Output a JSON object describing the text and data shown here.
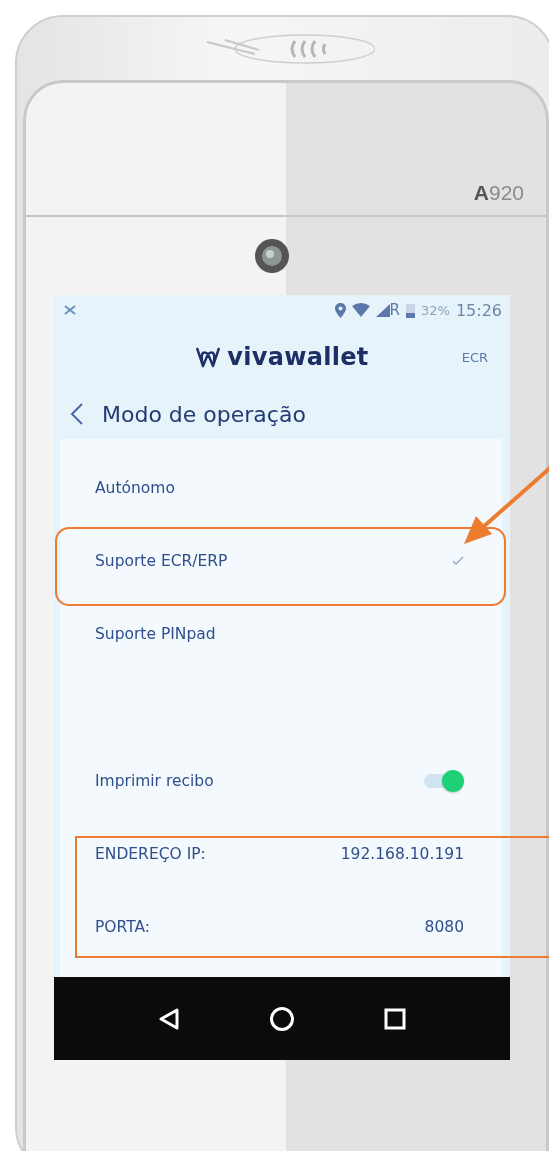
{
  "device": {
    "model": "**A**920"
  },
  "status_bar": {
    "network": "R",
    "battery": "32%",
    "time": "15:26"
  },
  "header": {
    "logo": "vivawallet",
    "mode": "ECR"
  },
  "title": "Modo de operação",
  "modes": [
    {
      "label": "Autónomo",
      "selected": false
    },
    {
      "label": "Suporte ECR/ERP",
      "selected": true
    },
    {
      "label": "Suporte PINpad",
      "selected": false
    }
  ],
  "print_receipt": {
    "label": "Imprimir recibo",
    "on": true
  },
  "fields": [
    {
      "label": "ENDEREÇO IP:",
      "value": "192.168.10.191"
    },
    {
      "label": "PORTA:",
      "value": "8080"
    }
  ]
}
